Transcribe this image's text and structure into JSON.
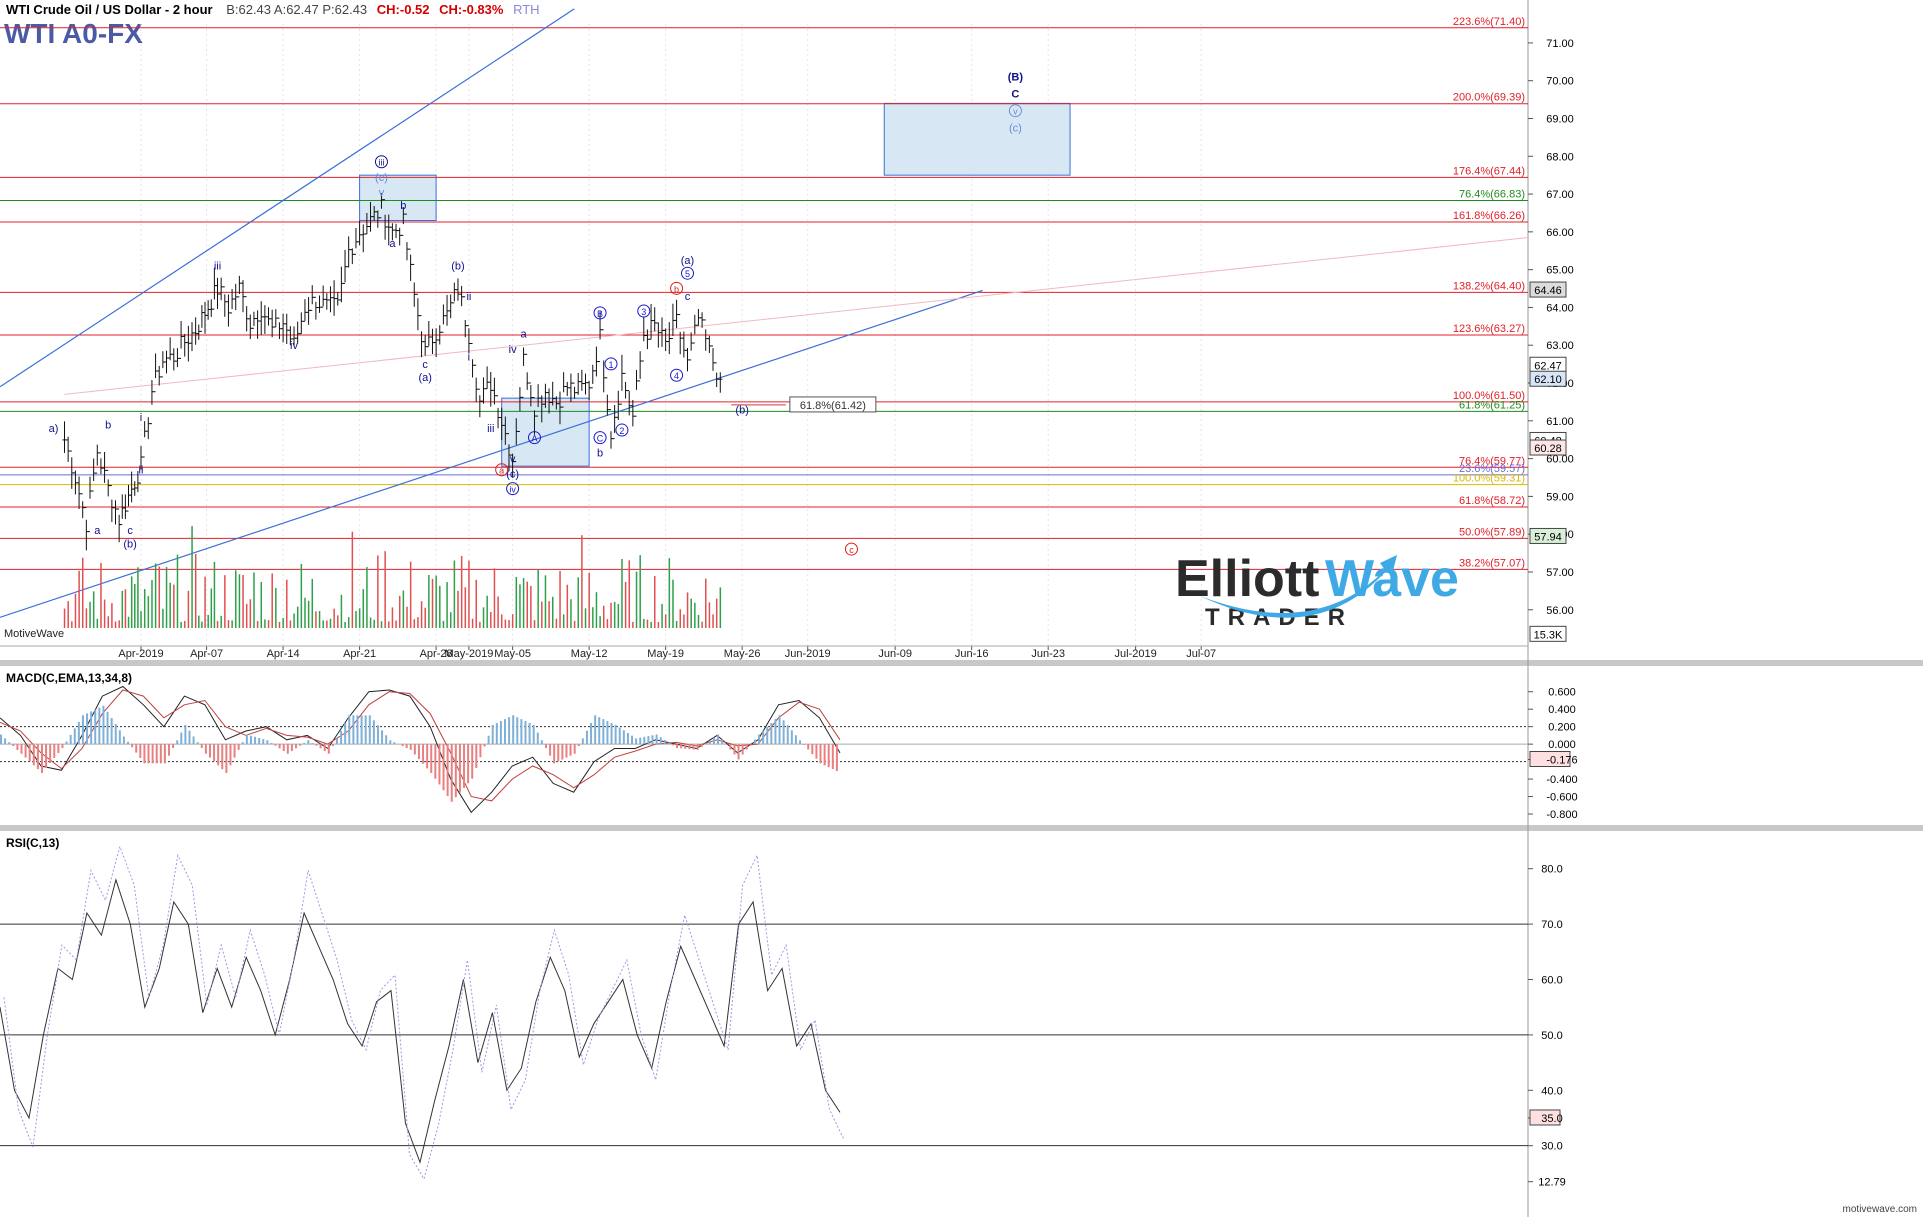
{
  "header": {
    "instrument": "WTI Crude Oil / US Dollar - 2 hour",
    "quote": "B:62.43  A:62.47  P:62.43",
    "change_abs": "CH:-0.52",
    "change_pct": "CH:-0.83%",
    "session": "RTH",
    "symbol": "WTI A0-FX"
  },
  "branding": {
    "elliott": "Elliott",
    "wave": "Wave",
    "trader": "TRADER",
    "motivewave_label": "MotiveWave",
    "footer_url": "motivewave.com"
  },
  "colors": {
    "fib_line": "#e0202a",
    "fib_green": "#1f8a1f",
    "fib_yellow": "#d8b800",
    "trendline": "#3a6fd8",
    "box_fill": "#d7e8f4",
    "box_stroke": "#3a6fd8",
    "wave_blue": "#1a1acc",
    "wave_red": "#dd1c1c",
    "volume_up": "#2ea04a",
    "volume_down": "#e05050",
    "macd_hist_up": "#7fb0d8",
    "macd_hist_down": "#e88080",
    "price_bar": "#111111"
  },
  "chart_data": [
    {
      "type": "ohlc",
      "title": "WTI Crude Oil / US Dollar - 2 hour",
      "ylim": [
        55.2,
        71.5
      ],
      "y_ticks": [
        "71.00",
        "70.00",
        "69.00",
        "68.00",
        "67.00",
        "66.00",
        "65.00",
        "64.00",
        "63.00",
        "62.00",
        "61.00",
        "60.00",
        "59.00",
        "58.00",
        "57.00",
        "56.00"
      ],
      "x_ticks": [
        "Apr-2019",
        "Apr-07",
        "Apr-14",
        "Apr-21",
        "Apr-28",
        "May-2019",
        "May-05",
        "May-12",
        "May-19",
        "May-26",
        "Jun-2019",
        "Jun-09",
        "Jun-16",
        "Jun-23",
        "Jul-2019",
        "Jul-07"
      ],
      "price_path": [
        {
          "d": "Mar-25",
          "p": 60.5
        },
        {
          "d": "Mar-26",
          "p": 59.5
        },
        {
          "d": "Mar-27",
          "p": 58.3
        },
        {
          "d": "Mar-28",
          "p": 60.2
        },
        {
          "d": "Mar-29",
          "p": 59.2
        },
        {
          "d": "Mar-30",
          "p": 58.4
        },
        {
          "d": "Apr-01",
          "p": 59.8
        },
        {
          "d": "Apr-02",
          "p": 61.8
        },
        {
          "d": "Apr-03",
          "p": 62.6
        },
        {
          "d": "Apr-04",
          "p": 62.7
        },
        {
          "d": "Apr-05",
          "p": 63.1
        },
        {
          "d": "Apr-06",
          "p": 63.4
        },
        {
          "d": "Apr-08",
          "p": 64.5
        },
        {
          "d": "Apr-09",
          "p": 64.0
        },
        {
          "d": "Apr-10",
          "p": 64.5
        },
        {
          "d": "Apr-11",
          "p": 63.6
        },
        {
          "d": "Apr-12",
          "p": 64.0
        },
        {
          "d": "Apr-13",
          "p": 63.4
        },
        {
          "d": "Apr-14",
          "p": 63.6
        },
        {
          "d": "Apr-15",
          "p": 63.0
        },
        {
          "d": "Apr-16",
          "p": 64.0
        },
        {
          "d": "Apr-17",
          "p": 64.2
        },
        {
          "d": "Apr-18",
          "p": 64.0
        },
        {
          "d": "Apr-19",
          "p": 64.0
        },
        {
          "d": "Apr-20",
          "p": 65.5
        },
        {
          "d": "Apr-21",
          "p": 66.0
        },
        {
          "d": "Apr-22",
          "p": 66.3
        },
        {
          "d": "Apr-23",
          "p": 66.6
        },
        {
          "d": "Apr-24",
          "p": 66.0
        },
        {
          "d": "Apr-25",
          "p": 66.2
        },
        {
          "d": "Apr-26",
          "p": 64.3
        },
        {
          "d": "Apr-27",
          "p": 62.8
        },
        {
          "d": "Apr-28",
          "p": 63.4
        },
        {
          "d": "Apr-29",
          "p": 63.8
        },
        {
          "d": "Apr-30",
          "p": 64.5
        },
        {
          "d": "May-01",
          "p": 63.3
        },
        {
          "d": "May-02",
          "p": 61.5
        },
        {
          "d": "May-03",
          "p": 62.0
        },
        {
          "d": "May-04",
          "p": 61.0
        },
        {
          "d": "May-05",
          "p": 60.0
        },
        {
          "d": "May-06",
          "p": 62.6
        },
        {
          "d": "May-07",
          "p": 61.4
        },
        {
          "d": "May-08",
          "p": 61.8
        },
        {
          "d": "May-09",
          "p": 61.5
        },
        {
          "d": "May-10",
          "p": 61.9
        },
        {
          "d": "May-11",
          "p": 61.8
        },
        {
          "d": "May-12",
          "p": 62.0
        },
        {
          "d": "May-13",
          "p": 63.2
        },
        {
          "d": "May-14",
          "p": 60.7
        },
        {
          "d": "May-15",
          "p": 62.2
        },
        {
          "d": "May-16",
          "p": 61.1
        },
        {
          "d": "May-17",
          "p": 63.3
        },
        {
          "d": "May-18",
          "p": 63.5
        },
        {
          "d": "May-19",
          "p": 63.0
        },
        {
          "d": "May-20",
          "p": 63.6
        },
        {
          "d": "May-21",
          "p": 62.5
        },
        {
          "d": "May-22",
          "p": 63.7
        },
        {
          "d": "May-23",
          "p": 62.8
        },
        {
          "d": "May-24",
          "p": 62.1
        }
      ],
      "fib_levels": [
        {
          "label": "223.6%(71.40)",
          "value": 71.4,
          "color": "red"
        },
        {
          "label": "200.0%(69.39)",
          "value": 69.39,
          "color": "red"
        },
        {
          "label": "176.4%(67.44)",
          "value": 67.44,
          "color": "red"
        },
        {
          "label": "76.4%(66.83)",
          "value": 66.83,
          "color": "green"
        },
        {
          "label": "161.8%(66.26)",
          "value": 66.26,
          "color": "red"
        },
        {
          "label": "138.2%(64.40)",
          "value": 64.4,
          "color": "red"
        },
        {
          "label": "123.6%(63.27)",
          "value": 63.27,
          "color": "red"
        },
        {
          "label": "100.0%(61.50)",
          "value": 61.5,
          "color": "red"
        },
        {
          "label": "61.8%(61.25)",
          "value": 61.25,
          "color": "green"
        },
        {
          "label": "76.4%(59.77)",
          "value": 59.77,
          "color": "red"
        },
        {
          "label": "23.6%(59.57)",
          "value": 59.57,
          "color": "blue"
        },
        {
          "label": "100.0%(59.31)",
          "value": 59.31,
          "color": "yellow"
        },
        {
          "label": "61.8%(58.72)",
          "value": 58.72,
          "color": "red"
        },
        {
          "label": "50.0%(57.89)",
          "value": 57.89,
          "color": "red"
        },
        {
          "label": "38.2%(57.07)",
          "value": 57.07,
          "color": "red"
        }
      ],
      "price_tags": [
        {
          "label": "64.46",
          "value": 64.46,
          "bg": "#dcdcdc"
        },
        {
          "label": "62.47",
          "value": 62.47,
          "bg": "#ffffff"
        },
        {
          "label": "62.10",
          "value": 62.1,
          "bg": "#d8e4f8"
        },
        {
          "label": "60.48",
          "value": 60.48,
          "bg": "#ffffff"
        },
        {
          "label": "60.28",
          "value": 60.28,
          "bg": "#ffe6e6"
        },
        {
          "label": "57.94",
          "value": 57.94,
          "bg": "#d8f0d8"
        },
        {
          "label": "15.3K",
          "value": 55.35,
          "bg": "#ffffff"
        }
      ],
      "annotation_label": "61.8%(61.42)",
      "wave_labels": [
        {
          "t": "(B)",
          "d": "Jun-20",
          "p": 70.0,
          "c": "navy",
          "bold": true
        },
        {
          "t": "C",
          "d": "Jun-20",
          "p": 69.55,
          "c": "navy",
          "bold": true
        },
        {
          "t": "v",
          "d": "Jun-20",
          "p": 69.1,
          "c": "light",
          "circle": true
        },
        {
          "t": "(c)",
          "d": "Jun-20",
          "p": 68.65,
          "c": "light"
        },
        {
          "t": "iii",
          "d": "Apr-23",
          "p": 67.75,
          "c": "navy",
          "circle": true
        },
        {
          "t": "(c)",
          "d": "Apr-23",
          "p": 67.35,
          "c": "light"
        },
        {
          "t": "v",
          "d": "Apr-23",
          "p": 66.95,
          "c": "light"
        },
        {
          "t": "b",
          "d": "Apr-25",
          "p": 66.6,
          "c": "navy"
        },
        {
          "t": "a",
          "d": "Apr-24",
          "p": 65.6,
          "c": "navy"
        },
        {
          "t": "iii",
          "d": "Apr-08",
          "p": 65.0,
          "c": "navy"
        },
        {
          "t": "iv",
          "d": "Apr-15",
          "p": 62.9,
          "c": "navy"
        },
        {
          "t": "(b)",
          "d": "Apr-30",
          "p": 65.0,
          "c": "navy"
        },
        {
          "t": "ii",
          "d": "May-01",
          "p": 64.2,
          "c": "navy"
        },
        {
          "t": "i",
          "d": "May-01",
          "p": 62.6,
          "c": "navy"
        },
        {
          "t": "c",
          "d": "Apr-27",
          "p": 62.4,
          "c": "navy"
        },
        {
          "t": "(a)",
          "d": "Apr-27",
          "p": 62.05,
          "c": "navy"
        },
        {
          "t": "a",
          "d": "May-06",
          "p": 63.2,
          "c": "navy"
        },
        {
          "t": "iv",
          "d": "May-05",
          "p": 62.8,
          "c": "navy"
        },
        {
          "t": "iii",
          "d": "May-03",
          "p": 60.7,
          "c": "navy"
        },
        {
          "t": "A",
          "d": "May-07",
          "p": 60.45,
          "c": "blue",
          "circle": true
        },
        {
          "t": "v",
          "d": "May-05",
          "p": 59.9,
          "c": "navy"
        },
        {
          "t": "(c)",
          "d": "May-05",
          "p": 59.5,
          "c": "navy"
        },
        {
          "t": "iv",
          "d": "May-05",
          "p": 59.1,
          "c": "blue",
          "circle": true
        },
        {
          "t": "a",
          "d": "May-04",
          "p": 59.6,
          "c": "red",
          "circle": true
        },
        {
          "t": "B",
          "d": "May-13",
          "p": 63.75,
          "c": "blue",
          "circle": true
        },
        {
          "t": "1",
          "d": "May-14",
          "p": 62.4,
          "c": "blue",
          "circle": true
        },
        {
          "t": "C",
          "d": "May-13",
          "p": 60.45,
          "c": "blue",
          "circle": true
        },
        {
          "t": "b",
          "d": "May-13",
          "p": 60.05,
          "c": "navy"
        },
        {
          "t": "2",
          "d": "May-15",
          "p": 60.65,
          "c": "blue",
          "circle": true
        },
        {
          "t": "3",
          "d": "May-17",
          "p": 63.8,
          "c": "blue",
          "circle": true
        },
        {
          "t": "4",
          "d": "May-20",
          "p": 62.1,
          "c": "blue",
          "circle": true
        },
        {
          "t": "5",
          "d": "May-21",
          "p": 64.8,
          "c": "blue",
          "circle": true
        },
        {
          "t": "c",
          "d": "May-21",
          "p": 64.2,
          "c": "navy"
        },
        {
          "t": "(a)",
          "d": "May-21",
          "p": 65.15,
          "c": "navy"
        },
        {
          "t": "b",
          "d": "May-20",
          "p": 64.4,
          "c": "red",
          "circle": true
        },
        {
          "t": "(b)",
          "d": "May-26",
          "p": 61.2,
          "c": "navy"
        },
        {
          "t": "c",
          "d": "Jun-05",
          "p": 57.5,
          "c": "red",
          "circle": true
        },
        {
          "t": "a",
          "d": "Mar-28",
          "p": 58.0,
          "c": "navy"
        },
        {
          "t": "b",
          "d": "Mar-29",
          "p": 60.8,
          "c": "navy"
        },
        {
          "t": "c",
          "d": "Mar-31",
          "p": 58.0,
          "c": "navy"
        },
        {
          "t": "(b)",
          "d": "Mar-31",
          "p": 57.65,
          "c": "navy"
        },
        {
          "t": "i",
          "d": "Apr-01",
          "p": 61.0,
          "c": "navy"
        },
        {
          "t": "ii",
          "d": "Apr-01",
          "p": 59.6,
          "c": "navy"
        },
        {
          "t": "a)",
          "d": "Mar-24",
          "p": 60.7,
          "c": "navy"
        }
      ],
      "target_boxes": [
        {
          "d0": "Jun-08",
          "d1": "Jun-25",
          "p0": 69.4,
          "p1": 67.5
        },
        {
          "d0": "Apr-21",
          "d1": "Apr-28",
          "p0": 67.5,
          "p1": 66.3
        },
        {
          "d0": "May-04",
          "d1": "May-12",
          "p0": 61.6,
          "p1": 59.8
        }
      ],
      "volume_label_note": "MotiveWave",
      "volume_max": 15.3
    },
    {
      "type": "line",
      "title": "MACD(C,EMA,13,34,8)",
      "ylim": [
        -0.88,
        0.78
      ],
      "y_ticks": [
        "0.600",
        "0.400",
        "0.200",
        "0.000",
        "-0.176",
        "-0.400",
        "-0.600",
        "-0.800"
      ],
      "series": [
        {
          "name": "MACD",
          "values": [
            0.3,
            0.1,
            -0.25,
            -0.3,
            0.1,
            0.55,
            0.66,
            0.45,
            0.2,
            0.55,
            0.45,
            0.05,
            0.15,
            0.2,
            0.05,
            0.1,
            -0.05,
            0.3,
            0.6,
            0.62,
            0.55,
            0.2,
            -0.4,
            -0.78,
            -0.55,
            -0.25,
            -0.15,
            -0.45,
            -0.55,
            -0.2,
            -0.05,
            -0.05,
            0.05,
            0.0,
            -0.05,
            0.1,
            -0.1,
            0.05,
            0.45,
            0.5,
            0.3,
            -0.1
          ]
        },
        {
          "name": "Signal",
          "values": [
            0.25,
            0.15,
            -0.1,
            -0.28,
            -0.05,
            0.35,
            0.62,
            0.55,
            0.3,
            0.45,
            0.5,
            0.2,
            0.1,
            0.18,
            0.1,
            0.08,
            0.0,
            0.15,
            0.45,
            0.6,
            0.58,
            0.35,
            -0.1,
            -0.6,
            -0.65,
            -0.4,
            -0.25,
            -0.35,
            -0.5,
            -0.35,
            -0.15,
            -0.08,
            0.0,
            0.02,
            -0.02,
            0.05,
            -0.02,
            0.0,
            0.3,
            0.48,
            0.4,
            0.05
          ]
        }
      ],
      "last_value": "-0.176"
    },
    {
      "type": "line",
      "title": "RSI(C,13)",
      "ylim": [
        22,
        85
      ],
      "y_ticks": [
        "80.0",
        "70.0",
        "60.0",
        "50.0",
        "40.0",
        "35.0",
        "30.0",
        "12.79"
      ],
      "guides": [
        70,
        50,
        30
      ],
      "series": [
        {
          "name": "RSI",
          "values": [
            55,
            40,
            35,
            50,
            62,
            60,
            72,
            68,
            78,
            70,
            55,
            62,
            74,
            70,
            54,
            62,
            55,
            64,
            58,
            50,
            60,
            72,
            66,
            60,
            52,
            48,
            56,
            58,
            34,
            27,
            38,
            48,
            60,
            45,
            54,
            40,
            44,
            56,
            64,
            58,
            46,
            52,
            56,
            60,
            50,
            44,
            56,
            66,
            60,
            54,
            48,
            70,
            74,
            58,
            62,
            48,
            52,
            40,
            36
          ]
        }
      ],
      "last_value": "35.0"
    }
  ]
}
